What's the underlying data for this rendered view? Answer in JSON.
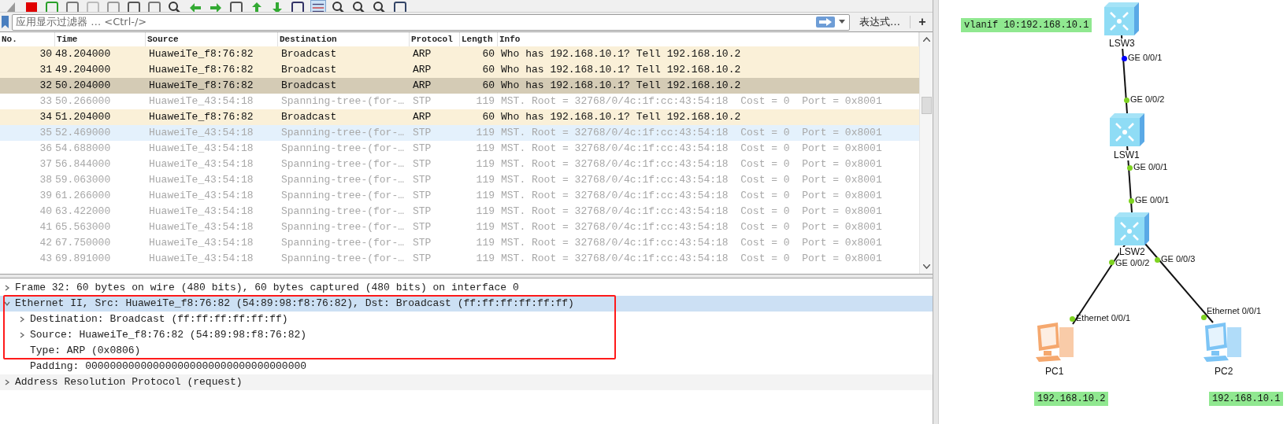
{
  "filter_bar": {
    "placeholder": "应用显示过滤器 … <Ctrl-/>",
    "expression_button": "表达式…",
    "add_button": "+"
  },
  "packet_list": {
    "columns": [
      "No.",
      "Time",
      "Source",
      "Destination",
      "Protocol",
      "Length",
      "Info"
    ],
    "rows": [
      {
        "kind": "arp",
        "selected": false,
        "hovered": false,
        "cells": [
          "30",
          "48.204000",
          "HuaweiTe_f8:76:82",
          "Broadcast",
          "ARP",
          "60",
          "Who has 192.168.10.1? Tell 192.168.10.2"
        ]
      },
      {
        "kind": "arp",
        "selected": false,
        "hovered": false,
        "cells": [
          "31",
          "49.204000",
          "HuaweiTe_f8:76:82",
          "Broadcast",
          "ARP",
          "60",
          "Who has 192.168.10.1? Tell 192.168.10.2"
        ]
      },
      {
        "kind": "arp",
        "selected": true,
        "hovered": false,
        "cells": [
          "32",
          "50.204000",
          "HuaweiTe_f8:76:82",
          "Broadcast",
          "ARP",
          "60",
          "Who has 192.168.10.1? Tell 192.168.10.2"
        ]
      },
      {
        "kind": "stp",
        "selected": false,
        "hovered": false,
        "cells": [
          "33",
          "50.266000",
          "HuaweiTe_43:54:18",
          "Spanning-tree-(for-…",
          "STP",
          "119",
          "MST. Root = 32768/0/4c:1f:cc:43:54:18  Cost = 0  Port = 0x8001"
        ]
      },
      {
        "kind": "arp",
        "selected": false,
        "hovered": false,
        "cells": [
          "34",
          "51.204000",
          "HuaweiTe_f8:76:82",
          "Broadcast",
          "ARP",
          "60",
          "Who has 192.168.10.1? Tell 192.168.10.2"
        ]
      },
      {
        "kind": "stp",
        "selected": false,
        "hovered": true,
        "cells": [
          "35",
          "52.469000",
          "HuaweiTe_43:54:18",
          "Spanning-tree-(for-…",
          "STP",
          "119",
          "MST. Root = 32768/0/4c:1f:cc:43:54:18  Cost = 0  Port = 0x8001"
        ]
      },
      {
        "kind": "stp",
        "selected": false,
        "hovered": false,
        "cells": [
          "36",
          "54.688000",
          "HuaweiTe_43:54:18",
          "Spanning-tree-(for-…",
          "STP",
          "119",
          "MST. Root = 32768/0/4c:1f:cc:43:54:18  Cost = 0  Port = 0x8001"
        ]
      },
      {
        "kind": "stp",
        "selected": false,
        "hovered": false,
        "cells": [
          "37",
          "56.844000",
          "HuaweiTe_43:54:18",
          "Spanning-tree-(for-…",
          "STP",
          "119",
          "MST. Root = 32768/0/4c:1f:cc:43:54:18  Cost = 0  Port = 0x8001"
        ]
      },
      {
        "kind": "stp",
        "selected": false,
        "hovered": false,
        "cells": [
          "38",
          "59.063000",
          "HuaweiTe_43:54:18",
          "Spanning-tree-(for-…",
          "STP",
          "119",
          "MST. Root = 32768/0/4c:1f:cc:43:54:18  Cost = 0  Port = 0x8001"
        ]
      },
      {
        "kind": "stp",
        "selected": false,
        "hovered": false,
        "cells": [
          "39",
          "61.266000",
          "HuaweiTe_43:54:18",
          "Spanning-tree-(for-…",
          "STP",
          "119",
          "MST. Root = 32768/0/4c:1f:cc:43:54:18  Cost = 0  Port = 0x8001"
        ]
      },
      {
        "kind": "stp",
        "selected": false,
        "hovered": false,
        "cells": [
          "40",
          "63.422000",
          "HuaweiTe_43:54:18",
          "Spanning-tree-(for-…",
          "STP",
          "119",
          "MST. Root = 32768/0/4c:1f:cc:43:54:18  Cost = 0  Port = 0x8001"
        ]
      },
      {
        "kind": "stp",
        "selected": false,
        "hovered": false,
        "cells": [
          "41",
          "65.563000",
          "HuaweiTe_43:54:18",
          "Spanning-tree-(for-…",
          "STP",
          "119",
          "MST. Root = 32768/0/4c:1f:cc:43:54:18  Cost = 0  Port = 0x8001"
        ]
      },
      {
        "kind": "stp",
        "selected": false,
        "hovered": false,
        "cells": [
          "42",
          "67.750000",
          "HuaweiTe_43:54:18",
          "Spanning-tree-(for-…",
          "STP",
          "119",
          "MST. Root = 32768/0/4c:1f:cc:43:54:18  Cost = 0  Port = 0x8001"
        ]
      },
      {
        "kind": "stp",
        "selected": false,
        "hovered": false,
        "cells": [
          "43",
          "69.891000",
          "HuaweiTe_43:54:18",
          "Spanning-tree-(for-…",
          "STP",
          "119",
          "MST. Root = 32768/0/4c:1f:cc:43:54:18  Cost = 0  Port = 0x8001"
        ]
      }
    ]
  },
  "details": [
    {
      "text": "Frame 32: 60 bytes on wire (480 bits), 60 bytes captured (480 bits) on interface 0",
      "expanded": false,
      "selected": false
    },
    {
      "text": "Ethernet II, Src: HuaweiTe_f8:76:82 (54:89:98:f8:76:82), Dst: Broadcast (ff:ff:ff:ff:ff:ff)",
      "expanded": true,
      "selected": true,
      "children": [
        {
          "text": "Destination: Broadcast (ff:ff:ff:ff:ff:ff)",
          "selected": false,
          "expandable": true
        },
        {
          "text": "Source: HuaweiTe_f8:76:82 (54:89:98:f8:76:82)",
          "selected": false,
          "expandable": true
        },
        {
          "text": "Type: ARP (0x0806)",
          "selected": false,
          "expandable": false
        },
        {
          "text": "Padding: 000000000000000000000000000000000000",
          "selected": false,
          "expandable": false
        }
      ]
    },
    {
      "text": "Address Resolution Protocol (request)",
      "expanded": false,
      "selected": false
    }
  ],
  "topology": {
    "annotations": [
      "vlanif 10:192.168.10.1",
      "192.168.10.2",
      "192.168.10.1"
    ],
    "nodes": [
      {
        "kind": "switch",
        "label": "LSW3",
        "color": "#8fdcf5"
      },
      {
        "kind": "switch",
        "label": "LSW1",
        "color": "#8fdcf5"
      },
      {
        "kind": "switch",
        "label": "LSW2",
        "color": "#8fdcf5"
      },
      {
        "kind": "pc",
        "label": "PC1",
        "color": "#f5a86e"
      },
      {
        "kind": "pc",
        "label": "PC2",
        "color": "#7cc4f5"
      }
    ],
    "ports": [
      {
        "label": "GE 0/0/1",
        "color": "#0000ff"
      },
      {
        "label": "GE 0/0/2",
        "color": "#7ed321"
      },
      {
        "label": "GE 0/0/1",
        "color": "#7ed321"
      },
      {
        "label": "GE 0/0/1",
        "color": "#7ed321"
      },
      {
        "label": "GE 0/0/2",
        "color": "#7ed321"
      },
      {
        "label": "GE 0/0/3",
        "color": "#7ed321"
      },
      {
        "label": "Ethernet 0/0/1",
        "color": "#7ed321"
      },
      {
        "label": "Ethernet 0/0/1",
        "color": "#7ed321"
      }
    ]
  }
}
